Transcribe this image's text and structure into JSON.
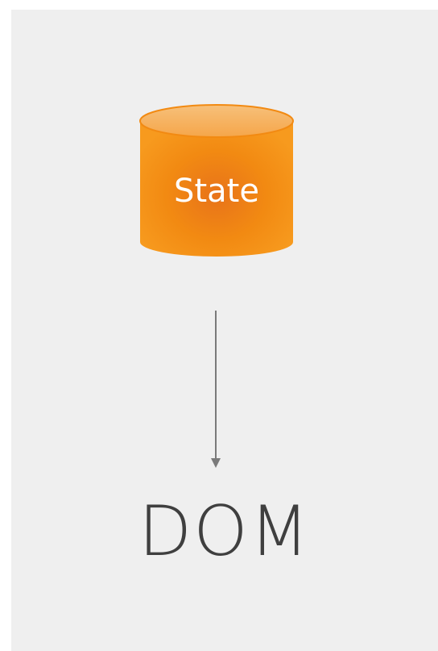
{
  "diagram": {
    "state_node": {
      "label": "State",
      "shape": "cylinder",
      "fill_color": "#f48a10",
      "highlight_color": "#f7b66a",
      "text_color": "#ffffff"
    },
    "arrow": {
      "direction": "down",
      "color": "#7a7a7a"
    },
    "dom_node": {
      "label": "DOM",
      "text_color": "#3f3f3f"
    },
    "background_color": "#efefef"
  }
}
